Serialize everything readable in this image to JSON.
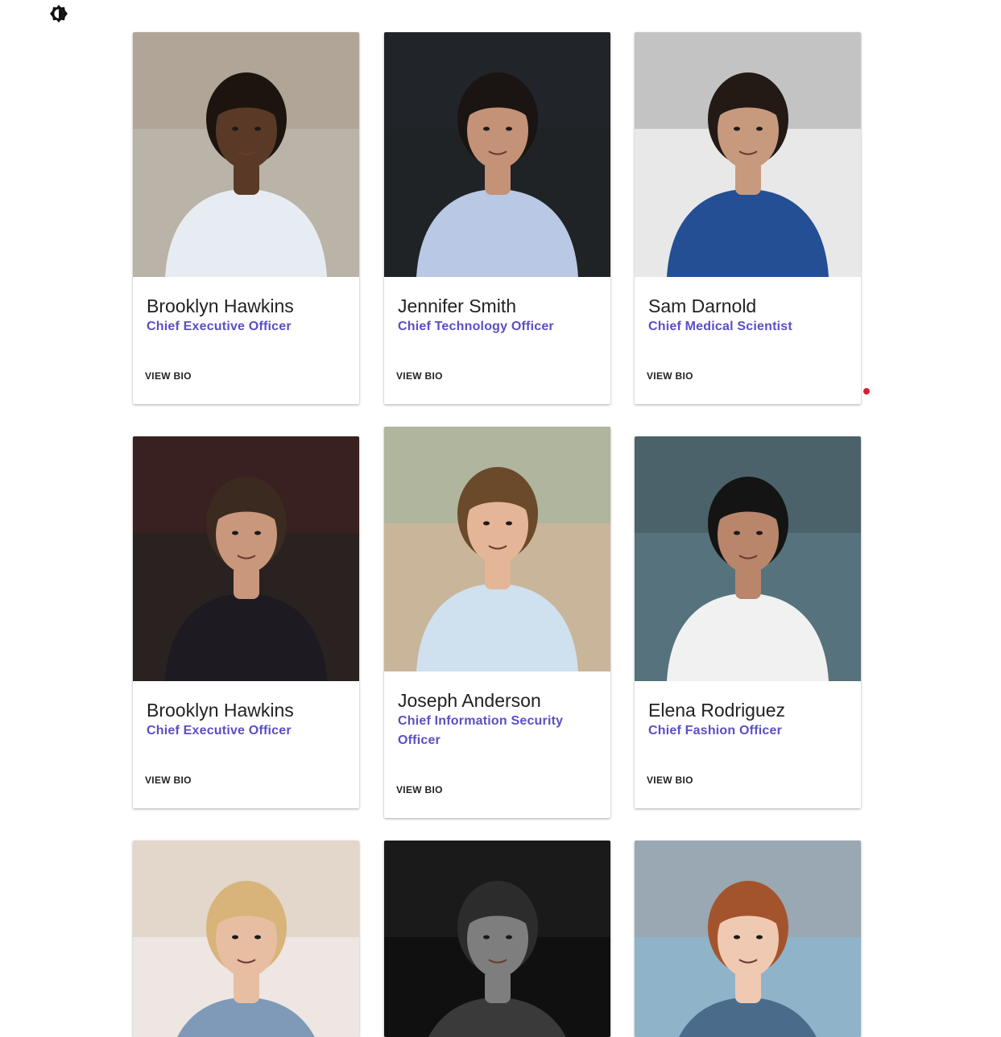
{
  "theme_toggle": {
    "icon": "brightness-icon"
  },
  "team": [
    {
      "name": "Brooklyn Hawkins",
      "role": "Chief Executive Officer",
      "action": "VIEW BIO",
      "photo": {
        "bg": "#b9b3a8",
        "skin": "#5a3a26",
        "shirt": "#e7ecf3",
        "hair": "#1c140f",
        "accent": "#8a6a48"
      }
    },
    {
      "name": "Jennifer Smith",
      "role": "Chief Technology Officer",
      "action": "VIEW BIO",
      "photo": {
        "bg": "#1f2326",
        "skin": "#c49277",
        "shirt": "#b9c8e4",
        "hair": "#1a1412",
        "accent": "#2a2a30"
      }
    },
    {
      "name": "Sam Darnold",
      "role": "Chief Medical Scientist",
      "action": "VIEW BIO",
      "photo": {
        "bg": "#e8e8e8",
        "skin": "#c79a7d",
        "shirt": "#244f94",
        "hair": "#231a16",
        "accent": "#1b1b1b"
      }
    },
    {
      "name": "Brooklyn Hawkins",
      "role": "Chief Executive Officer",
      "action": "VIEW BIO",
      "photo": {
        "bg": "#2a2220",
        "skin": "#c8977c",
        "shirt": "#1d1a21",
        "hair": "#3a2a1f",
        "accent": "#7a1f24"
      }
    },
    {
      "name": "Joseph Anderson",
      "role": "Chief Information Security Officer",
      "action": "VIEW BIO",
      "photo": {
        "bg": "#c9b59a",
        "skin": "#e4b596",
        "shirt": "#cfe0ee",
        "hair": "#6b4a2c",
        "accent": "#40b7b0"
      }
    },
    {
      "name": "Elena Rodriguez",
      "role": "Chief Fashion Officer",
      "action": "VIEW BIO",
      "photo": {
        "bg": "#56727c",
        "skin": "#b9856b",
        "shirt": "#f1f1f1",
        "hair": "#141414",
        "accent": "#1b1b1b"
      }
    },
    {
      "name": "",
      "role": "",
      "action": "",
      "photo": {
        "bg": "#ede6e2",
        "skin": "#e8bea3",
        "shirt": "#7f9ab8",
        "hair": "#d8b47a",
        "accent": "#b58e62"
      }
    },
    {
      "name": "",
      "role": "",
      "action": "",
      "photo": {
        "bg": "#101010",
        "skin": "#7e7e7e",
        "shirt": "#3a3a3a",
        "hair": "#2c2c2c",
        "accent": "#4a4a4a"
      }
    },
    {
      "name": "",
      "role": "",
      "action": "",
      "photo": {
        "bg": "#8fb3c9",
        "skin": "#f0c9b2",
        "shirt": "#4a6c8a",
        "hair": "#a4542c",
        "accent": "#c57a4e"
      }
    }
  ]
}
